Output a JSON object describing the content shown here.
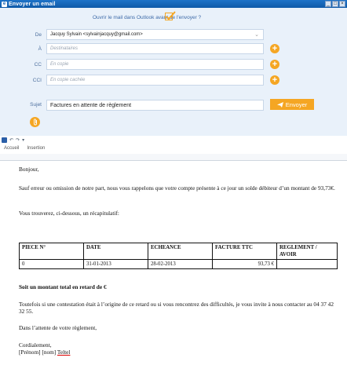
{
  "window": {
    "title": "Envoyer un email",
    "buttons": [
      "_",
      "□",
      "×"
    ]
  },
  "form": {
    "question": "Ouvrir le mail dans Outlook avant de l'envoyer ?",
    "from_label": "De",
    "from_value": "Jacquy Sylvain <sylvainjacquy@gmail.com>",
    "to_label": "À",
    "to_placeholder": "Destinataires",
    "cc_label": "CC",
    "cc_placeholder": "En copie",
    "cci_label": "CCI",
    "cci_placeholder": "En copie cachée",
    "subject_label": "Sujet",
    "subject_value": "Factures en attente de règlement",
    "send_label": "Envoyer"
  },
  "ribbon": {
    "tabs": [
      "Accueil",
      "Insertion"
    ]
  },
  "document": {
    "greeting": "Bonjour,",
    "para1": "Sauf erreur ou omission de notre part, nous vous rappelons que votre compte présente à ce jour un solde débiteur d’un montant de 93,73€.",
    "para2": "Vous trouverez, ci-dessous, un récapitulatif:",
    "table": {
      "headers": [
        "PIECE N°",
        "DATE",
        "ECHEANCE",
        "FACTURE TTC",
        "REGLEMENT / AVOIR"
      ],
      "rows": [
        [
          "0",
          "31-01-2013",
          "28-02-2013",
          "93,73 €",
          ""
        ]
      ]
    },
    "total_line": "Soit un montant total en retard de €",
    "para3": "Toutefois si une contestation était à l’origine de ce retard ou si vous rencontrez des difficultés, je vous invite à nous contacter au 04 37 42 32 55.",
    "para4": "Dans l’attente de votre règlement,",
    "closing": "Cordialement,",
    "signature_prefix": "[Prénom] [nom] ",
    "signature_company": "Teltel"
  },
  "colors": {
    "accent": "#f5a623",
    "panel": "#e9f1fa",
    "title_bar": "#1565b8"
  }
}
